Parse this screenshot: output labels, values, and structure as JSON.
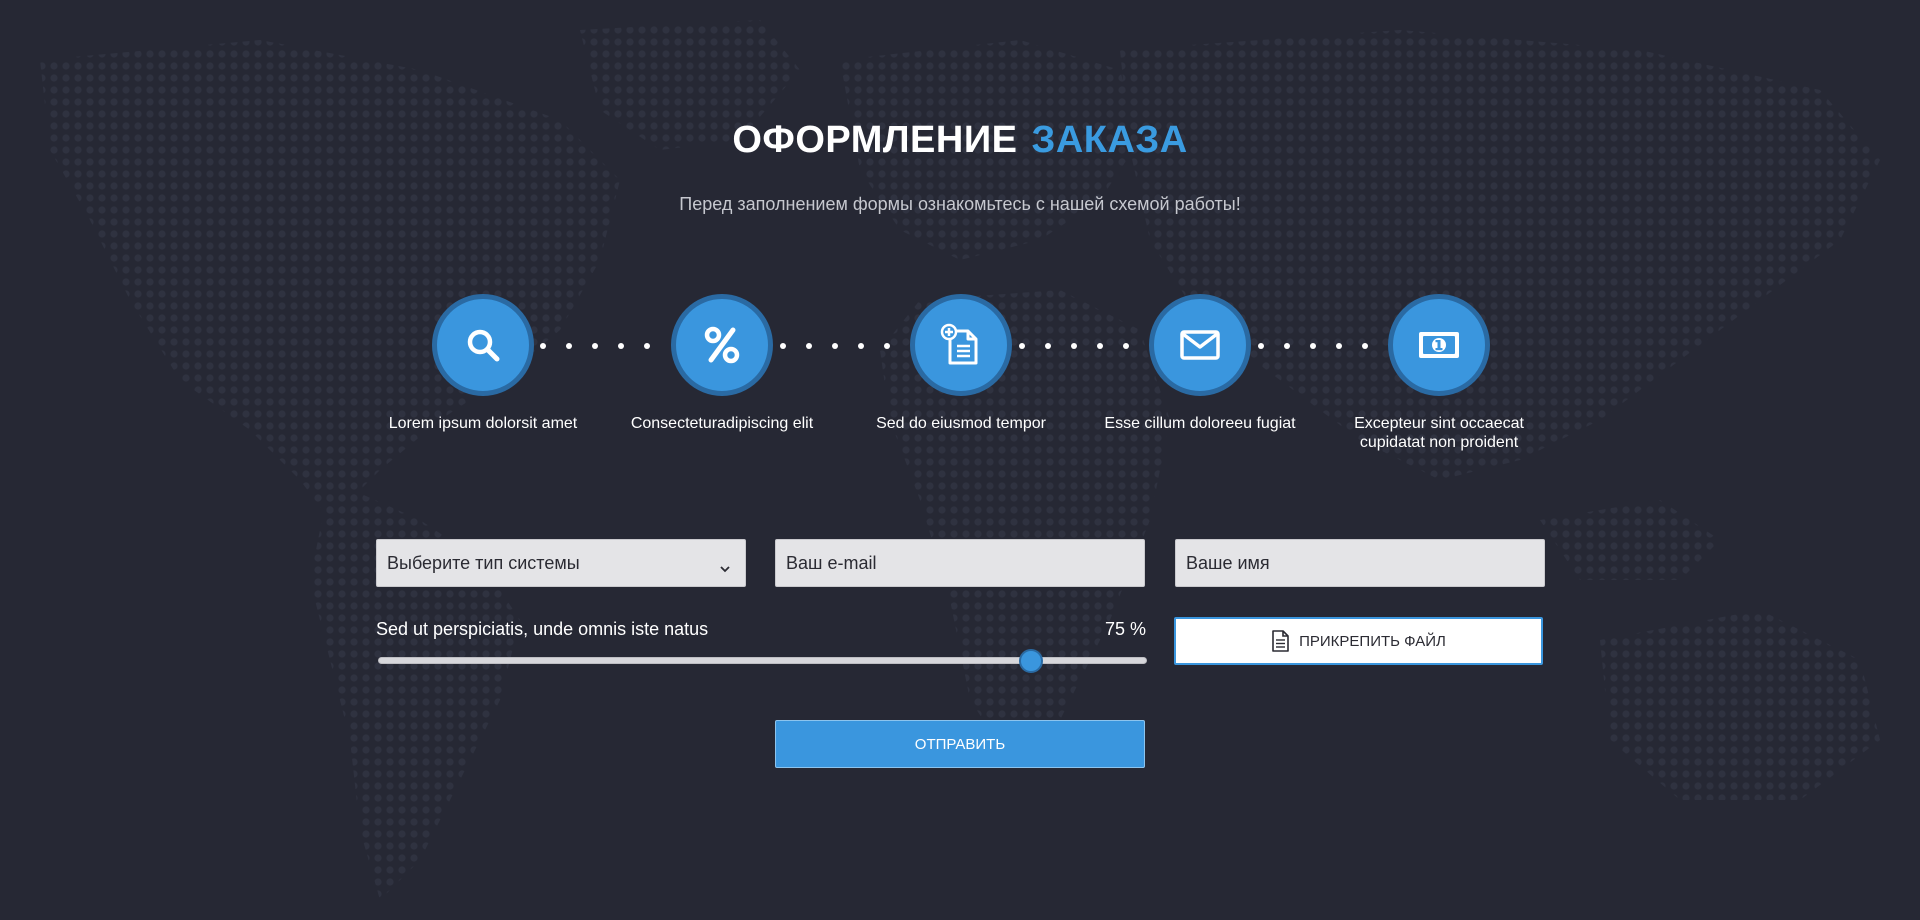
{
  "header": {
    "title_white": "ОФОРМЛЕНИЕ",
    "title_blue": "ЗАКАЗА",
    "subtitle": "Перед заполнением формы ознакомьтесь с нашей схемой работы!"
  },
  "steps": [
    {
      "icon": "search-icon",
      "label": "Lorem ipsum dolorsit amet"
    },
    {
      "icon": "percent-icon",
      "label": "Consecteturadipiscing elit"
    },
    {
      "icon": "document-add-icon",
      "label": "Sed do eiusmod tempor"
    },
    {
      "icon": "envelope-icon",
      "label": "Esse cillum doloreeu fugiat"
    },
    {
      "icon": "banknote-icon",
      "label": "Excepteur sint occaecat cupidatat non proident"
    }
  ],
  "form": {
    "system_select": "Выберите тип системы",
    "email_placeholder": "Ваш e-mail",
    "name_placeholder": "Ваше имя",
    "slider_label": "Sed ut perspiciatis, unde omnis iste natus",
    "slider_value_text": "75 %",
    "slider_value": 0.85,
    "attach_label": "ПРИКРЕПИТЬ ФАЙЛ",
    "submit_label": "ОТПРАВИТЬ"
  },
  "colors": {
    "background": "#262834",
    "accent": "#3a96de",
    "accent_dark": "#2a6aa3"
  }
}
